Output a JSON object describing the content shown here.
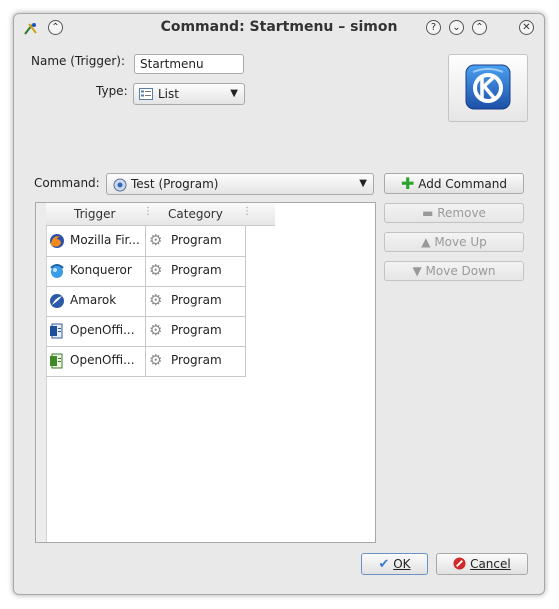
{
  "window": {
    "title": "Command: Startmenu – simon"
  },
  "form": {
    "name_label": "Name (Trigger):",
    "name_value": "Startmenu",
    "type_label": "Type:",
    "type_value": "List",
    "command_label": "Command:",
    "command_value": "Test (Program)"
  },
  "side_buttons": {
    "add": "Add Command",
    "remove": "Remove",
    "move_up": "Move Up",
    "move_down": "Move Down"
  },
  "table": {
    "headers": [
      "Trigger",
      "Category"
    ],
    "rows": [
      {
        "trigger": "Mozilla Fir...",
        "category": "Program",
        "icon": "firefox-icon"
      },
      {
        "trigger": "Konqueror",
        "category": "Program",
        "icon": "konqueror-icon"
      },
      {
        "trigger": "Amarok",
        "category": "Program",
        "icon": "amarok-icon"
      },
      {
        "trigger": "OpenOffi...",
        "category": "Program",
        "icon": "openoffice-writer-icon"
      },
      {
        "trigger": "OpenOffi...",
        "category": "Program",
        "icon": "openoffice-calc-icon"
      }
    ]
  },
  "footer": {
    "ok": "OK",
    "cancel": "Cancel"
  },
  "colors": {
    "accent": "#3a7bd5",
    "add_green": "#2ea42e",
    "cancel_red": "#d02a2a"
  }
}
